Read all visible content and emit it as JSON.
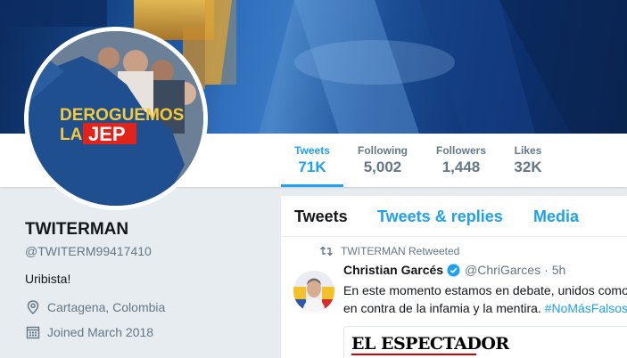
{
  "profile": {
    "name": "TWITERMAN",
    "handle": "@TWITERM99417410",
    "bio": "Uribista!",
    "location": "Cartagena, Colombia",
    "joined": "Joined March 2018",
    "avatar_text": {
      "line1": "DEROGUEMOS",
      "line2_prefix": "LA",
      "line2_highlight": "JEP"
    }
  },
  "stats": [
    {
      "label": "Tweets",
      "value": "71K"
    },
    {
      "label": "Following",
      "value": "5,002"
    },
    {
      "label": "Followers",
      "value": "1,448"
    },
    {
      "label": "Likes",
      "value": "32K"
    }
  ],
  "tabs": [
    {
      "label": "Tweets"
    },
    {
      "label": "Tweets & replies"
    },
    {
      "label": "Media"
    }
  ],
  "tweet": {
    "retweet_label": "TWITERMAN Retweeted",
    "author_name": "Christian Garcés",
    "author_handle": "@ChriGarces",
    "separator": "·",
    "time": "5h",
    "line1": "En este momento estamos en debate, unidos como",
    "line2": "en contra de la infamia y la mentira.",
    "hashtag": "#NoMásFalsos"
  },
  "card": {
    "logo": "EL ESPECTADOR"
  },
  "colors": {
    "accent": "#1da1f2",
    "muted": "#657786",
    "background": "#e6ecf0"
  },
  "icons": [
    "location-icon",
    "calendar-icon",
    "retweet-icon",
    "verified-icon"
  ]
}
